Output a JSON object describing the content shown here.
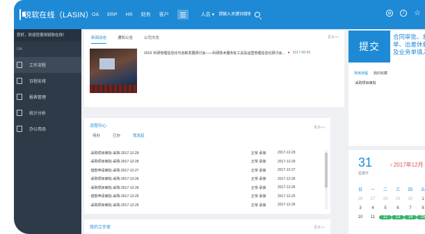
{
  "header": {
    "brand": "锐软在线（LASIN）",
    "nav": [
      "OA",
      "ERP",
      "HR",
      "财务",
      "客户"
    ],
    "people_select": "人员 ▾",
    "search_placeholder": "请输入关键词搜索"
  },
  "sidebar": {
    "welcome": "您好，欢迎您使用锐软在线！",
    "user": "OA",
    "items": [
      {
        "label": "工作流程",
        "active": true
      },
      {
        "label": "日程安排",
        "active": false
      },
      {
        "label": "报表管理",
        "active": false
      },
      {
        "label": "统计分析",
        "active": false
      },
      {
        "label": "办公用品",
        "active": false
      }
    ]
  },
  "news": {
    "tabs": [
      "新闻动态",
      "通知公告",
      "公司文化"
    ],
    "more": "更多>>",
    "headline": "2016' 科研管理信息化与创新发展研讨会——科研技术服务处工具及运营管理信息化研讨会...",
    "date": "2017-06-05"
  },
  "todo": {
    "title": "流程中心",
    "more": "更多>>",
    "tabs": [
      "待办",
      "已办",
      "我发起"
    ],
    "rows": [
      {
        "title": "·采购项目审批-采购-2017-12-29",
        "status": "正常 承接",
        "date": "2017-12-29"
      },
      {
        "title": "·采购项目审批-采购-2017-12-29",
        "status": "正常 承接",
        "date": "2017-12-29"
      },
      {
        "title": "·借款申请审批-采购-2017-12-27",
        "status": "正常 承接",
        "date": "2017-12-27"
      },
      {
        "title": "·采购项目审批-采购-2017-12-26",
        "status": "正常 承接",
        "date": "2017-12-26"
      },
      {
        "title": "·采购项目审批-采购-2017-12-26",
        "status": "正常 承接",
        "date": "2017-12-26"
      },
      {
        "title": "·借款申请审批-采购-2017-12-25",
        "status": "正常 承接",
        "date": "2017-12-25"
      },
      {
        "title": "·采购项目审批-采购-2017-12-25",
        "status": "正常 承接",
        "date": "2017-12-25"
      }
    ]
  },
  "bottom_card": {
    "title": "我的工作室",
    "more": "更多>>"
  },
  "submit": {
    "button": "提交",
    "hint_lines": [
      "合同审批、差旅",
      "单、出差休假申",
      "及业务单填入口"
    ]
  },
  "quick_links": {
    "tabs": [
      "常用流程",
      "我的收藏"
    ],
    "item": "·采购项目审批"
  },
  "calendar": {
    "day": "31",
    "sub": "星期日",
    "month": "‹  2017年12月",
    "weekdays": [
      "日",
      "一",
      "二",
      "三",
      "四",
      "五"
    ],
    "days": [
      {
        "d": "26",
        "muted": true,
        "mark": false
      },
      {
        "d": "27",
        "muted": true,
        "mark": false
      },
      {
        "d": "28",
        "muted": true,
        "mark": false
      },
      {
        "d": "29",
        "muted": true,
        "mark": false
      },
      {
        "d": "30",
        "muted": true,
        "mark": false
      },
      {
        "d": "1",
        "muted": false,
        "mark": false
      },
      {
        "d": "3",
        "muted": false,
        "mark": false
      },
      {
        "d": "4",
        "muted": false,
        "mark": false
      },
      {
        "d": "5",
        "muted": false,
        "mark": false
      },
      {
        "d": "6",
        "muted": false,
        "mark": false
      },
      {
        "d": "7",
        "muted": false,
        "mark": false
      },
      {
        "d": "8",
        "muted": false,
        "mark": false
      },
      {
        "d": "10",
        "muted": false,
        "mark": false
      },
      {
        "d": "11",
        "muted": false,
        "mark": false
      },
      {
        "d": "12",
        "muted": false,
        "mark": true
      },
      {
        "d": "13",
        "muted": false,
        "mark": true
      },
      {
        "d": "14",
        "muted": false,
        "mark": true
      },
      {
        "d": "15",
        "muted": false,
        "mark": true
      }
    ]
  },
  "colors": {
    "primary": "#1e8ad6",
    "sidebar": "#2f3a48",
    "accent_red": "#d9534f",
    "green": "#3cb371"
  }
}
